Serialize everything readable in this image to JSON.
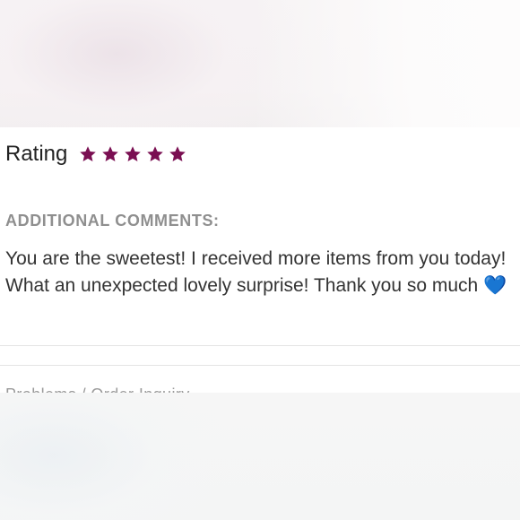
{
  "review": {
    "rating_label": "Rating",
    "rating_value": 5,
    "rating_max": 5,
    "star_color": "#7a0f52",
    "comments_heading": "ADDITIONAL COMMENTS:",
    "comment_text": "You are the sweetest! I received more items from you today! What an unexpected lovely surprise! Thank you so much 💙",
    "next_section_heading": "Problems / Order Inquiry"
  },
  "icons": {
    "star": "star-icon"
  }
}
